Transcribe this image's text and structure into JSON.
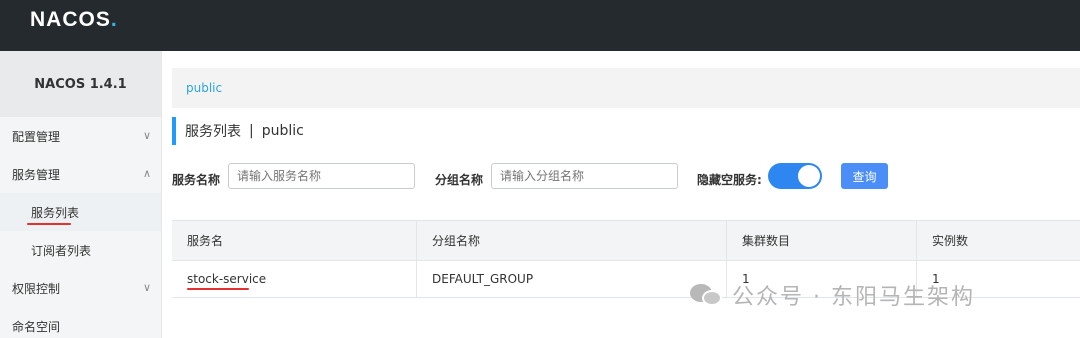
{
  "header": {
    "logo_text": "NACOS",
    "logo_dot": "."
  },
  "sidebar": {
    "title": "NACOS 1.4.1",
    "items": [
      {
        "label": "配置管理",
        "chevron": "∨"
      },
      {
        "label": "服务管理",
        "chevron": "∧"
      },
      {
        "label": "服务列表"
      },
      {
        "label": "订阅者列表"
      },
      {
        "label": "权限控制",
        "chevron": "∨"
      },
      {
        "label": "命名空间"
      }
    ]
  },
  "breadcrumb": {
    "namespace": "public"
  },
  "page": {
    "title": "服务列表",
    "separator": "|",
    "namespace": "public"
  },
  "filters": {
    "service_name_label": "服务名称",
    "service_name_placeholder": "请输入服务名称",
    "group_name_label": "分组名称",
    "group_name_placeholder": "请输入分组名称",
    "hide_empty_label": "隐藏空服务:",
    "hide_empty_on": true,
    "query_button": "查询"
  },
  "table": {
    "columns": [
      "服务名",
      "分组名称",
      "集群数目",
      "实例数"
    ],
    "rows": [
      {
        "service": "stock-service",
        "group": "DEFAULT_GROUP",
        "clusters": "1",
        "instances": "1"
      }
    ]
  },
  "watermark": {
    "text": "公众号 · 东阳马生架构",
    "icon": "wechat-icon"
  },
  "colors": {
    "topbar": "#252a2f",
    "accent": "#209bfa",
    "button": "#4c8ef7",
    "annotation": "#e53030"
  }
}
